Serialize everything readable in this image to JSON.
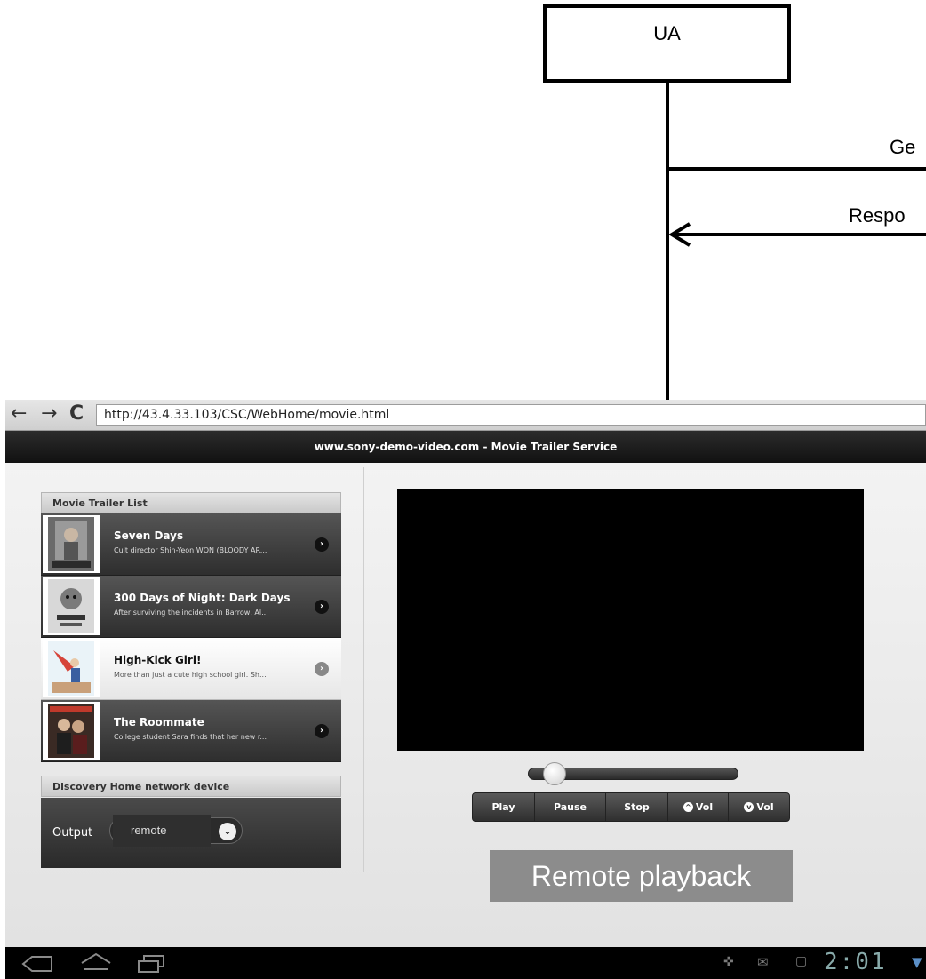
{
  "diagram": {
    "participant": "UA",
    "messages": [
      {
        "label": "Ge",
        "direction": "outgoing"
      },
      {
        "label": "Respo",
        "direction": "incoming"
      }
    ]
  },
  "browser": {
    "back_icon": "back-arrow-icon",
    "forward_icon": "forward-arrow-icon",
    "reload_icon": "reload-icon",
    "url": "http://43.4.33.103/CSC/WebHome/movie.html"
  },
  "site": {
    "header_title": "www.sony-demo-video.com - Movie Trailer Service"
  },
  "movie_list": {
    "title": "Movie Trailer List",
    "items": [
      {
        "title": "Seven Days",
        "description": "Cult director Shin-Yeon WON (BLOODY AR...",
        "active": false
      },
      {
        "title": "300 Days of Night: Dark Days",
        "description": "After surviving the incidents in Barrow, Al...",
        "active": false
      },
      {
        "title": "High-Kick Girl!",
        "description": "More than just a cute high school girl. Sh...",
        "active": true
      },
      {
        "title": "The Roommate",
        "description": "College student Sara finds that her new r...",
        "active": false
      }
    ]
  },
  "discovery": {
    "title": "Discovery Home network device",
    "output_label": "Output",
    "output_value": "remote"
  },
  "player": {
    "progress": 0.08,
    "controls": {
      "play": "Play",
      "pause": "Pause",
      "stop": "Stop",
      "vol_up": "Vol",
      "vol_down": "Vol"
    },
    "remote_label": "Remote playback"
  },
  "system_bar": {
    "time": "2:01",
    "icons": [
      "back-icon",
      "home-icon",
      "recent-apps-icon",
      "usb-icon",
      "gmail-icon",
      "calendar-icon",
      "wifi-icon"
    ]
  },
  "colors": {
    "header_bg": "#1a1a1a",
    "list_row_bg": "#3f3f3f",
    "active_row_bg": "#f5f5f5",
    "remote_label_bg": "#8c8c8c"
  }
}
